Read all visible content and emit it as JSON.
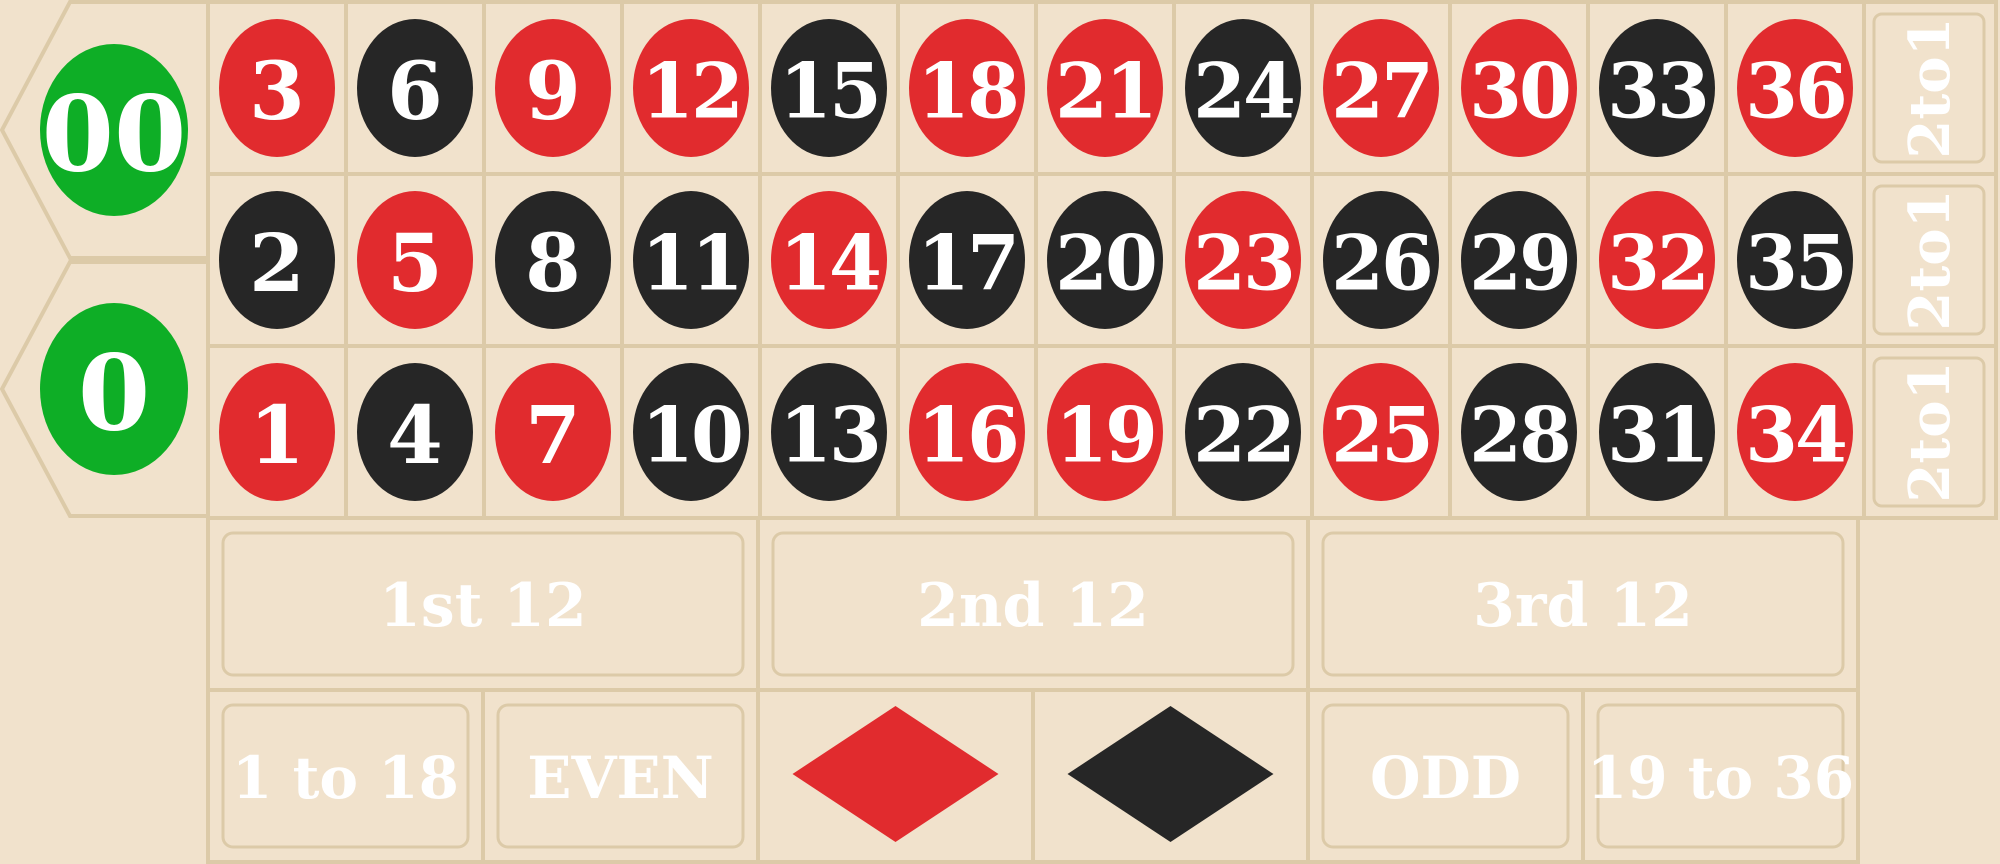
{
  "colors": {
    "felt": "#f1e2cc",
    "line": "#dccaa8",
    "red": "#e12b2e",
    "black": "#262626",
    "green": "#0eae26",
    "text": "#ffffff"
  },
  "zeros": [
    {
      "label": "00",
      "color": "green"
    },
    {
      "label": "0",
      "color": "green"
    }
  ],
  "numbers": {
    "top_row": [
      {
        "n": "3",
        "color": "red"
      },
      {
        "n": "6",
        "color": "black"
      },
      {
        "n": "9",
        "color": "red"
      },
      {
        "n": "12",
        "color": "red"
      },
      {
        "n": "15",
        "color": "black"
      },
      {
        "n": "18",
        "color": "red"
      },
      {
        "n": "21",
        "color": "red"
      },
      {
        "n": "24",
        "color": "black"
      },
      {
        "n": "27",
        "color": "red"
      },
      {
        "n": "30",
        "color": "red"
      },
      {
        "n": "33",
        "color": "black"
      },
      {
        "n": "36",
        "color": "red"
      }
    ],
    "middle_row": [
      {
        "n": "2",
        "color": "black"
      },
      {
        "n": "5",
        "color": "red"
      },
      {
        "n": "8",
        "color": "black"
      },
      {
        "n": "11",
        "color": "black"
      },
      {
        "n": "14",
        "color": "red"
      },
      {
        "n": "17",
        "color": "black"
      },
      {
        "n": "20",
        "color": "black"
      },
      {
        "n": "23",
        "color": "red"
      },
      {
        "n": "26",
        "color": "black"
      },
      {
        "n": "29",
        "color": "black"
      },
      {
        "n": "32",
        "color": "red"
      },
      {
        "n": "35",
        "color": "black"
      }
    ],
    "bottom_row": [
      {
        "n": "1",
        "color": "red"
      },
      {
        "n": "4",
        "color": "black"
      },
      {
        "n": "7",
        "color": "red"
      },
      {
        "n": "10",
        "color": "black"
      },
      {
        "n": "13",
        "color": "black"
      },
      {
        "n": "16",
        "color": "red"
      },
      {
        "n": "19",
        "color": "red"
      },
      {
        "n": "22",
        "color": "black"
      },
      {
        "n": "25",
        "color": "red"
      },
      {
        "n": "28",
        "color": "black"
      },
      {
        "n": "31",
        "color": "black"
      },
      {
        "n": "34",
        "color": "red"
      }
    ]
  },
  "columns": [
    "2to1",
    "2to1",
    "2to1"
  ],
  "dozens": [
    "1st 12",
    "2nd 12",
    "3rd 12"
  ],
  "outside_bets": [
    {
      "label": "1 to 18"
    },
    {
      "label": "EVEN"
    },
    {
      "label": "",
      "icon": "red-diamond-icon",
      "color": "red"
    },
    {
      "label": "",
      "icon": "black-diamond-icon",
      "color": "black"
    },
    {
      "label": "ODD"
    },
    {
      "label": "19 to 36"
    }
  ]
}
